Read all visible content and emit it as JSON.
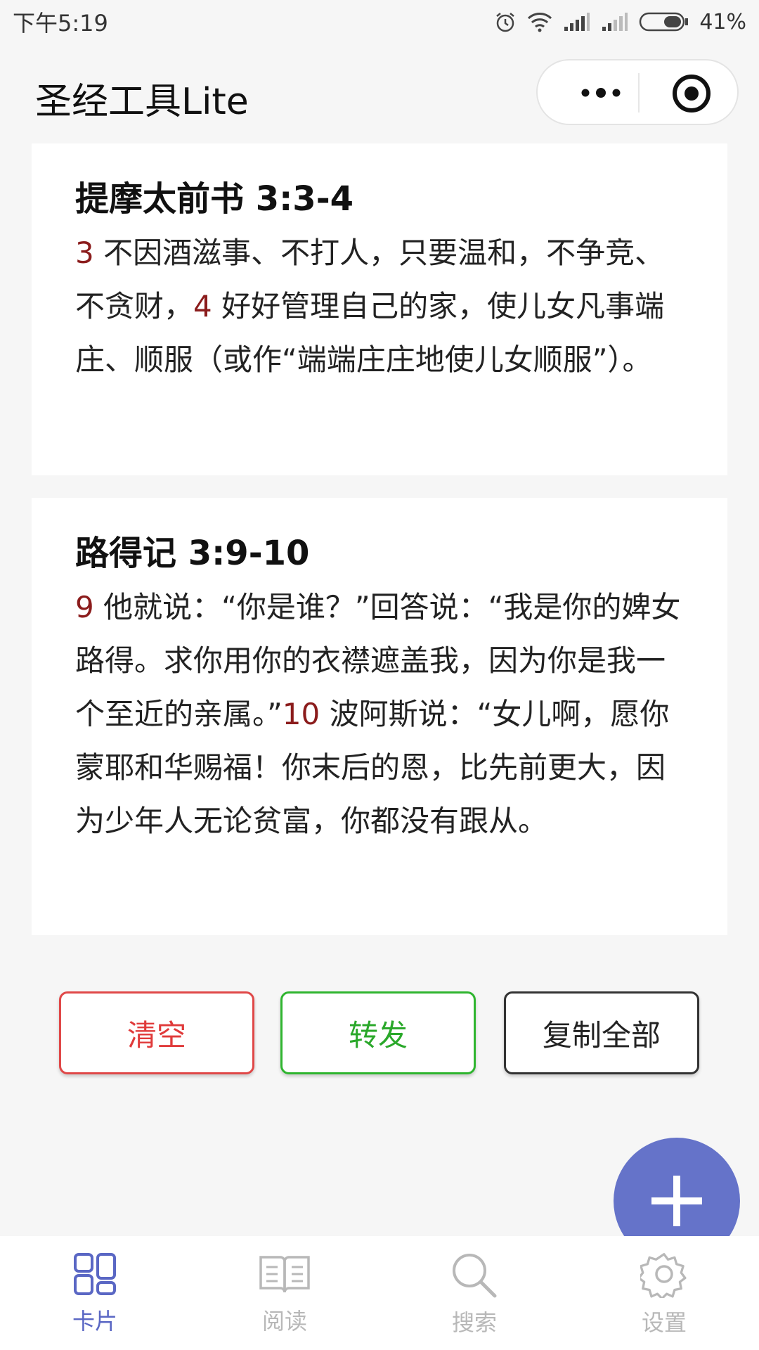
{
  "status_bar": {
    "time": "下午5:19",
    "battery": "41%",
    "icons": [
      "alarm-icon",
      "wifi-icon",
      "signal-icon",
      "signal-icon-2",
      "battery-icon"
    ]
  },
  "nav": {
    "title": "圣经工具Lite",
    "capsule_icons": [
      "more-icon",
      "target-icon"
    ]
  },
  "cards": [
    {
      "ref": "提摩太前书 3:3-4",
      "verses": [
        {
          "num": "3",
          "text": " 不因酒滋事、不打人，只要温和，不争竞、不贪财，"
        },
        {
          "num": "4",
          "text": " 好好管理自己的家，使儿女凡事端庄、顺服（或作“端端庄庄地使儿女顺服”）。"
        }
      ]
    },
    {
      "ref": "路得记 3:9-10",
      "verses": [
        {
          "num": "9",
          "text": " 他就说：“你是谁？”回答说：“我是你的婢女路得。求你用你的衣襟遮盖我，因为你是我一个至近的亲属。”"
        },
        {
          "num": "10",
          "text": " 波阿斯说：“女儿啊，愿你蒙耶和华赐福！你末后的恩，比先前更大，因为少年人无论贫富，你都没有跟从。"
        }
      ]
    }
  ],
  "actions": {
    "clear": "清空",
    "share": "转发",
    "copy_all": "复制全部"
  },
  "fab": {
    "icon": "plus-icon"
  },
  "tabs": [
    {
      "label": "卡片",
      "icon": "cards-icon",
      "active": true
    },
    {
      "label": "阅读",
      "icon": "book-icon",
      "active": false
    },
    {
      "label": "搜索",
      "icon": "search-icon",
      "active": false
    },
    {
      "label": "设置",
      "icon": "gear-icon",
      "active": false
    }
  ],
  "colors": {
    "accent": "#5a67c4",
    "fab": "#6573c9",
    "verse_number": "#8b1c1c",
    "clear": "#e03a3a",
    "share": "#2aa82a",
    "inactive_tab": "#b8b8b8"
  }
}
